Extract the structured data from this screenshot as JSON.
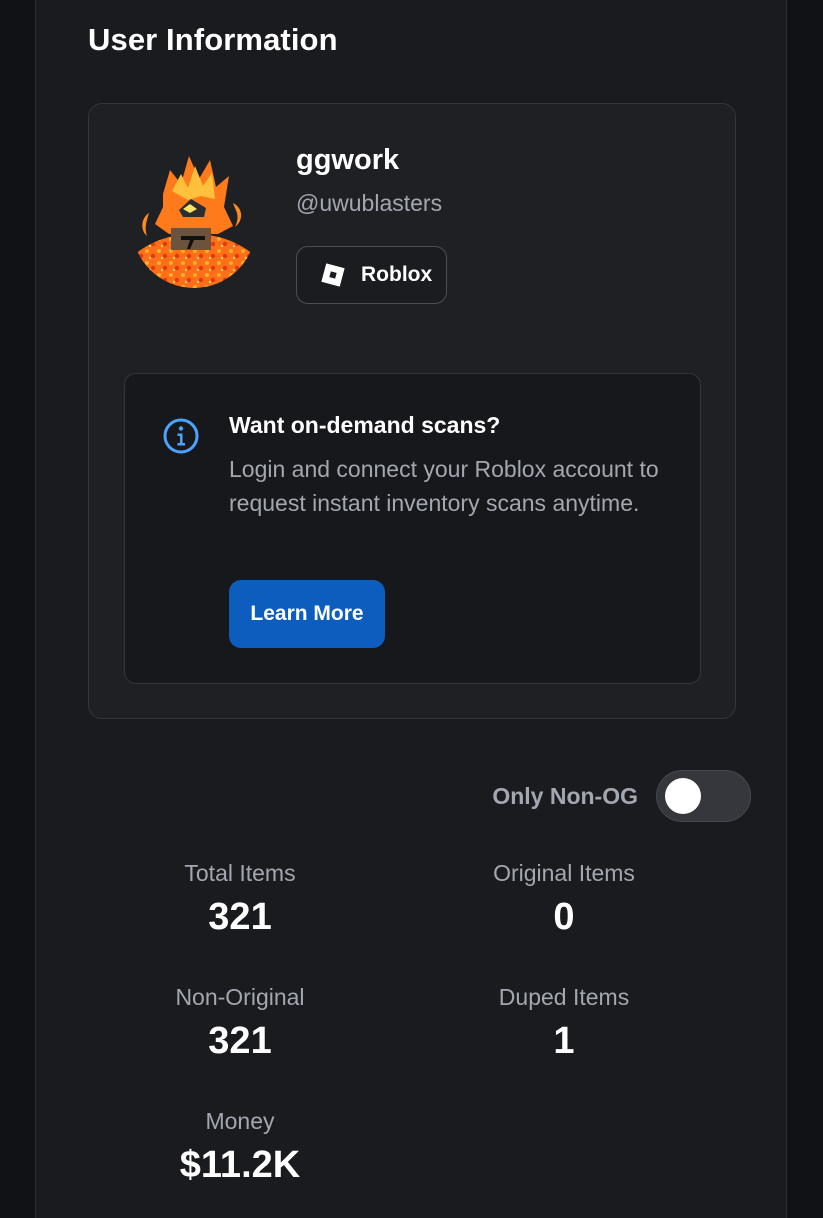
{
  "section": {
    "title": "User Information"
  },
  "profile": {
    "display_name": "ggwork",
    "username": "@uwublasters",
    "platform": "Roblox",
    "avatar_icon": "flame-avatar-icon",
    "platform_icon": "roblox-icon"
  },
  "info_box": {
    "icon": "info-icon",
    "title": "Want on-demand scans?",
    "body": "Login and connect your Roblox account to request instant inventory scans anytime.",
    "button_label": "Learn More"
  },
  "filters": {
    "non_og_label": "Only Non-OG",
    "non_og_enabled": false
  },
  "stats": [
    {
      "label": "Total Items",
      "value": "321"
    },
    {
      "label": "Original Items",
      "value": "0"
    },
    {
      "label": "Non-Original",
      "value": "321"
    },
    {
      "label": "Duped Items",
      "value": "1"
    },
    {
      "label": "Money",
      "value": "$11.2K"
    }
  ],
  "colors": {
    "page_background": "#111215",
    "panel_background": "#1a1b1f",
    "card_background": "#1f2024",
    "accent": "#0d5dbf",
    "muted_text": "#a3a7b0",
    "info_icon": "#4ba3ff"
  }
}
